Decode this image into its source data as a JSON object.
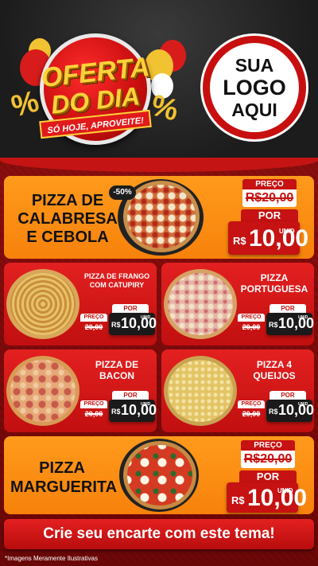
{
  "header": {
    "offer_line1": "OFERTA",
    "offer_line2": "DO DIA",
    "offer_ribbon": "SÓ HOJE, APROVEITE!",
    "logo_line1": "SUA",
    "logo_line2": "LOGO",
    "logo_line3": "AQUI",
    "percent_symbol": "%"
  },
  "products": [
    {
      "name_line1": "PIZZA DE",
      "name_line2": "CALABRESA",
      "name_line3": "E CEBOLA",
      "discount": "-50%",
      "preco_label": "PREÇO",
      "old_price": "R$20,00",
      "por_label": "POR",
      "currency": "R$",
      "price": "10,00",
      "unit": "UNID"
    },
    {
      "name_line1": "PIZZA DE FRANGO",
      "name_line2": "COM CATUPIRY",
      "preco_label": "PREÇO",
      "old_price": "20,00",
      "por_label": "POR",
      "currency": "R$",
      "price": "10,00",
      "unit": "UNID"
    },
    {
      "name_line1": "PIZZA",
      "name_line2": "PORTUGUESA",
      "preco_label": "PREÇO",
      "old_price": "20,00",
      "por_label": "POR",
      "currency": "R$",
      "price": "10,00",
      "unit": "UNID"
    },
    {
      "name_line1": "PIZZA DE",
      "name_line2": "BACON",
      "preco_label": "PREÇO",
      "old_price": "20,00",
      "por_label": "POR",
      "currency": "R$",
      "price": "10,00",
      "unit": "UNID"
    },
    {
      "name_line1": "PIZZA 4",
      "name_line2": "QUEIJOS",
      "preco_label": "PREÇO",
      "old_price": "20,00",
      "por_label": "POR",
      "currency": "R$",
      "price": "10,00",
      "unit": "UNID"
    },
    {
      "name_line1": "PIZZA",
      "name_line2": "MARGUERITA",
      "preco_label": "PREÇO",
      "old_price": "R$20,00",
      "por_label": "POR",
      "currency": "R$",
      "price": "10,00",
      "unit": "UNID"
    }
  ],
  "cta": "Crie seu encarte com este tema!",
  "footnote": "*Imagens Meramente Ilustrativas",
  "colors": {
    "accent_red": "#c61212",
    "accent_orange": "#f7820b",
    "gold": "#ffd23a"
  }
}
